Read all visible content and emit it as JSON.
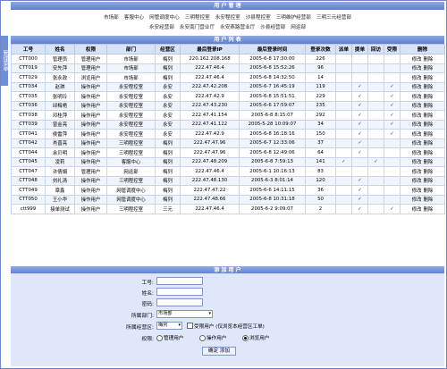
{
  "titles": {
    "user_mgmt": "用 户 管 理",
    "user_list": "用 户 列 表",
    "add_user": "添 加 用 户",
    "side_tab": "管理菜单"
  },
  "departments_row1": [
    "市场部",
    "客服中心",
    "网管调度中心",
    "三明程控室",
    "永安程控室",
    "沙县程控室",
    "三明维护经营部",
    "三明三元经营部"
  ],
  "departments_row2": [
    "永安经营部",
    "永安南门营业厅",
    "永安燕路营业厅",
    "沙县经营部",
    "网运部"
  ],
  "columns": [
    "工号",
    "姓名",
    "权限",
    "部门",
    "经营区",
    "最后登录IP",
    "最后登录时间",
    "登录次数",
    "派单",
    "提单",
    "回访",
    "受限",
    "删除"
  ],
  "rows": [
    {
      "id": "CTT000",
      "name": "管理员",
      "role": "管理用户",
      "dept": "市场部",
      "area": "梅列",
      "ip": "220.162.208.168",
      "time": "2005-6-8 17:30:00",
      "count": "226",
      "c1": "",
      "c2": "",
      "c3": "",
      "c4": ""
    },
    {
      "id": "CTT019",
      "name": "安先萍",
      "role": "管理用户",
      "dept": "市场部",
      "area": "梅列",
      "ip": "222.47.46.4",
      "time": "2005-6-8 15:52:26",
      "count": "96",
      "c1": "",
      "c2": "",
      "c3": "",
      "c4": ""
    },
    {
      "id": "CTT029",
      "name": "张永政",
      "role": "浏览用户",
      "dept": "市场部",
      "area": "梅列",
      "ip": "222.47.46.4",
      "time": "2005-6-8 14:32:50",
      "count": "14",
      "c1": "",
      "c2": "",
      "c3": "",
      "c4": ""
    },
    {
      "id": "CTT034",
      "name": "赵琪",
      "role": "操作用户",
      "dept": "永安程控室",
      "area": "永安",
      "ip": "222.47.42.208",
      "time": "2005-6-7 16:45:19",
      "count": "119",
      "c1": "",
      "c2": "✓",
      "c3": "",
      "c4": "✓"
    },
    {
      "id": "CTT035",
      "name": "张明玲",
      "role": "操作用户",
      "dept": "永安程控室",
      "area": "永安",
      "ip": "222.47.42.9",
      "time": "2005-6-8 15:51:51",
      "count": "229",
      "c1": "",
      "c2": "✓",
      "c3": "",
      "c4": "✓"
    },
    {
      "id": "CTT036",
      "name": "邱梅艳",
      "role": "操作用户",
      "dept": "永安程控室",
      "area": "永安",
      "ip": "222.47.43.230",
      "time": "2005-6-6 17:59:07",
      "count": "235",
      "c1": "",
      "c2": "✓",
      "c3": "",
      "c4": "✓"
    },
    {
      "id": "CTT038",
      "name": "邓桂萍",
      "role": "操作用户",
      "dept": "永安程控室",
      "area": "永安",
      "ip": "222.47.41.154",
      "time": "2005-6-8 8:15:07",
      "count": "292",
      "c1": "",
      "c2": "✓",
      "c3": "",
      "c4": "✓"
    },
    {
      "id": "CTT039",
      "name": "曾金亮",
      "role": "操作用户",
      "dept": "永安程控室",
      "area": "永安",
      "ip": "222.47.41.122",
      "time": "2005-5-28 10:09:07",
      "count": "34",
      "c1": "",
      "c2": "✓",
      "c3": "",
      "c4": "✓"
    },
    {
      "id": "CTT041",
      "name": "侯雷萍",
      "role": "操作用户",
      "dept": "永安程控室",
      "area": "永安",
      "ip": "222.47.42.9",
      "time": "2005-6-8 16:18:16",
      "count": "150",
      "c1": "",
      "c2": "✓",
      "c3": "",
      "c4": "✓"
    },
    {
      "id": "CTT042",
      "name": "肖晋亮",
      "role": "操作用户",
      "dept": "三明程控室",
      "area": "梅列",
      "ip": "222.47.47.96",
      "time": "2005-6-7 12:33:06",
      "count": "37",
      "c1": "",
      "c2": "✓",
      "c3": "",
      "c4": ""
    },
    {
      "id": "CTT044",
      "name": "余贝明",
      "role": "操作用户",
      "dept": "三明程控室",
      "area": "梅列",
      "ip": "222.47.47.96",
      "time": "2005-6-8 12:49:06",
      "count": "64",
      "c1": "",
      "c2": "✓",
      "c3": "",
      "c4": ""
    },
    {
      "id": "CTT045",
      "name": "凌莉",
      "role": "操作用户",
      "dept": "客服中心",
      "area": "梅列",
      "ip": "222.47.48.209",
      "time": "2005-6-8 7:59:13",
      "count": "141",
      "c1": "✓",
      "c2": "",
      "c3": "✓",
      "c4": ""
    },
    {
      "id": "CTT047",
      "name": "许倩娟",
      "role": "管理用户",
      "dept": "网运部",
      "area": "梅列",
      "ip": "222.47.46.4",
      "time": "2005-6-1 10:16:13",
      "count": "83",
      "c1": "",
      "c2": "",
      "c3": "",
      "c4": ""
    },
    {
      "id": "CTT048",
      "name": "刘礼清",
      "role": "操作用户",
      "dept": "三明程控室",
      "area": "梅列",
      "ip": "222.47.48.130",
      "time": "2005-6-3 8:01:14",
      "count": "120",
      "c1": "",
      "c2": "✓",
      "c3": "",
      "c4": ""
    },
    {
      "id": "CTT049",
      "name": "章鑫",
      "role": "操作用户",
      "dept": "网管调度中心",
      "area": "梅列",
      "ip": "222.47.47.22",
      "time": "2005-6-6 14:11:15",
      "count": "36",
      "c1": "",
      "c2": "✓",
      "c3": "",
      "c4": ""
    },
    {
      "id": "CTT050",
      "name": "王小华",
      "role": "操作用户",
      "dept": "网管调度中心",
      "area": "梅列",
      "ip": "222.47.48.66",
      "time": "2005-6-8 10:31:18",
      "count": "50",
      "c1": "",
      "c2": "✓",
      "c3": "",
      "c4": ""
    },
    {
      "id": "ctt999",
      "name": "接单测试",
      "role": "操作用户",
      "dept": "三明程控室",
      "area": "三元",
      "ip": "222.47.46.4",
      "time": "2005-6-2 9:09:07",
      "count": "2",
      "c1": "",
      "c2": "✓",
      "c3": "",
      "c4": "✓"
    }
  ],
  "row_actions": {
    "edit": "修改",
    "delete": "删除"
  },
  "form": {
    "id_label": "工号:",
    "name_label": "姓名:",
    "pwd_label": "密码:",
    "dept_label": "所属部门:",
    "dept_value": "市场部",
    "area_label": "所属经营区:",
    "area_value": "梅列",
    "restricted_label": "受限用户 (仅浏览本经营区工单)",
    "role_label": "权限:",
    "role_options": [
      "管理用户",
      "操作用户",
      "浏览用户"
    ],
    "submit_label": "确定 添加"
  }
}
